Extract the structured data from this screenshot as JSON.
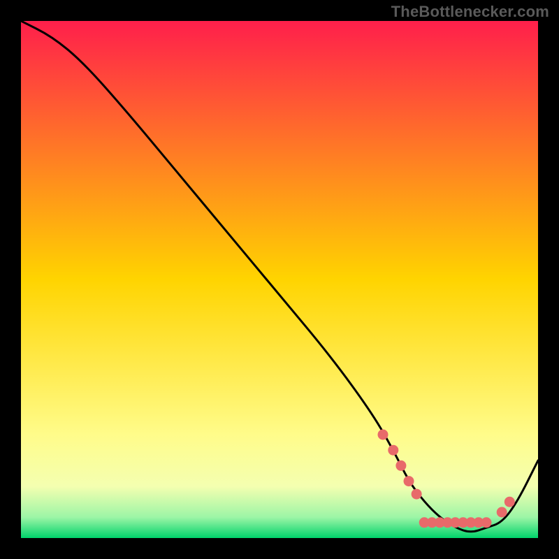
{
  "attribution": "TheBottlenecker.com",
  "chart_data": {
    "type": "line",
    "title": "",
    "xlabel": "",
    "ylabel": "",
    "xlim": [
      0,
      100
    ],
    "ylim": [
      0,
      100
    ],
    "background_gradient": {
      "stops": [
        {
          "offset": 0,
          "color": "#ff1f4b"
        },
        {
          "offset": 50,
          "color": "#ffd400"
        },
        {
          "offset": 80,
          "color": "#fffc8a"
        },
        {
          "offset": 90,
          "color": "#f4ffb0"
        },
        {
          "offset": 96,
          "color": "#9cf5a6"
        },
        {
          "offset": 100,
          "color": "#00d36b"
        }
      ]
    },
    "series": [
      {
        "name": "bottleneck-curve",
        "x": [
          0,
          6,
          12,
          20,
          30,
          40,
          50,
          60,
          68,
          72,
          75,
          78,
          81,
          84,
          87,
          90,
          93,
          96,
          100
        ],
        "y": [
          100,
          97,
          92,
          83,
          71,
          59,
          47,
          35,
          24,
          17,
          11,
          7,
          4,
          2,
          1,
          2,
          3,
          7,
          15
        ]
      }
    ],
    "markers": {
      "name": "highlight-dots",
      "color": "#e86a6a",
      "points": [
        {
          "x": 70,
          "y": 20
        },
        {
          "x": 72,
          "y": 17
        },
        {
          "x": 73.5,
          "y": 14
        },
        {
          "x": 75,
          "y": 11
        },
        {
          "x": 76.5,
          "y": 8.5
        },
        {
          "x": 78,
          "y": 3
        },
        {
          "x": 79.5,
          "y": 3
        },
        {
          "x": 81,
          "y": 3
        },
        {
          "x": 82.5,
          "y": 3
        },
        {
          "x": 84,
          "y": 3
        },
        {
          "x": 85.5,
          "y": 3
        },
        {
          "x": 87,
          "y": 3
        },
        {
          "x": 88.5,
          "y": 3
        },
        {
          "x": 90,
          "y": 3
        },
        {
          "x": 93,
          "y": 5
        },
        {
          "x": 94.5,
          "y": 7
        }
      ]
    }
  }
}
